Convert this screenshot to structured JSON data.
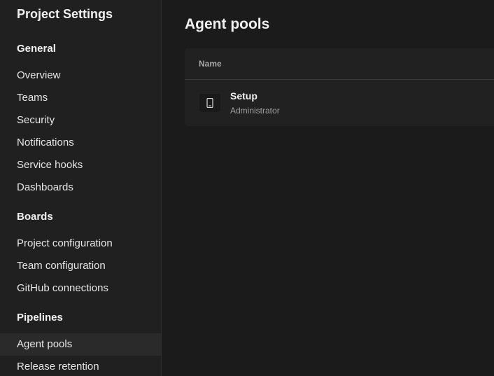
{
  "sidebar": {
    "title": "Project Settings",
    "sections": [
      {
        "header": "General",
        "items": [
          "Overview",
          "Teams",
          "Security",
          "Notifications",
          "Service hooks",
          "Dashboards"
        ]
      },
      {
        "header": "Boards",
        "items": [
          "Project configuration",
          "Team configuration",
          "GitHub connections"
        ]
      },
      {
        "header": "Pipelines",
        "items": [
          "Agent pools",
          "Release retention"
        ]
      }
    ],
    "selected_item": "Agent pools"
  },
  "main": {
    "title": "Agent pools",
    "table": {
      "columns": [
        "Name"
      ],
      "rows": [
        {
          "icon": "phone-device-icon",
          "name": "Setup",
          "subtitle": "Administrator"
        }
      ]
    }
  },
  "colors": {
    "background": "#1b1b1b",
    "sidebar_bg": "#202020",
    "card_bg": "#212121",
    "selected_bg": "#2a2a2a",
    "text_primary": "#f0f0f0",
    "text_secondary": "#a0a0a0"
  }
}
